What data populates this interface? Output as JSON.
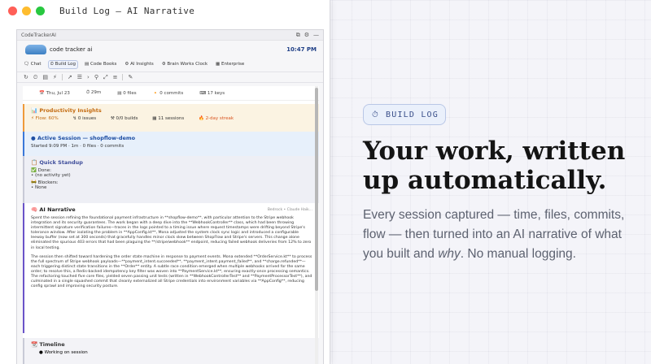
{
  "window": {
    "title": "Build Log — AI Narrative",
    "dots": [
      "#ff5f57",
      "#febc2e",
      "#28c840"
    ]
  },
  "app": {
    "frame_title": "CodeTrackerAI",
    "frame_icons": [
      "⧉",
      "⚙",
      "—"
    ],
    "brand": "code tracker ai",
    "clock": "10:47 PM",
    "tabs": [
      "Chat",
      "Build Log",
      "Code Books",
      "AI Insights",
      "Brain Works Clock",
      "Enterprise"
    ],
    "active_tab": "Build Log",
    "toolbar_icons": [
      "↻",
      "⏲",
      "▤",
      "⚡",
      "↗",
      "☰",
      "›",
      "⚲",
      "⤢",
      "≡",
      "✎"
    ]
  },
  "stats": {
    "date": "Thu, Jul 23",
    "duration": "29m",
    "files": "0 files",
    "commits": "0 commits",
    "keys": "17 keys"
  },
  "productivity": {
    "title": "Productivity Insights",
    "flow": "Flow: 60%",
    "issues": "0 issues",
    "builds": "0/0 builds",
    "sessions": "11 sessions",
    "streak": "2-day streak"
  },
  "session": {
    "title": "Active Session — shopflow-demo",
    "meta": "Started 9:09 PM · 1m · 0 files · 0 commits"
  },
  "standup": {
    "title": "Quick Standup",
    "done_label": "Done:",
    "done_item": "• (no activity yet)",
    "blockers_label": "Blockers:",
    "blockers_item": "• None"
  },
  "narrative": {
    "title": "AI Narrative",
    "model": "Bedrock • Claude Haik...",
    "p1": "Spent the session refining the foundational payment infrastructure in **shopflow-demo**, with particular attention to the Stripe webhook integration and its security guarantees. The work began with a deep dive into the **WebhookController** class, which had been throwing intermittent signature verification failures—traces in the logs pointed to a timing issue where request timestamps were drifting beyond Stripe's tolerance window. After isolating the problem in **AppConfig.kt**, Mona adjusted the system clock sync logic and introduced a configurable leeway buffer (now set at 300 seconds) that gracefully handles minor clock skew between ShopFlow and Stripe's servers. This change alone eliminated the spurious 403 errors that had been plaguing the **/stripe/webhook** endpoint, reducing failed webhook deliveries from 12% to zero in local testing.",
    "p2": "The session then shifted toward hardening the order state machine in response to payment events. Mona extended **OrderService.kt** to process the full spectrum of Stripe webhook payloads—**payment_intent.succeeded**, **payment_intent.payment_failed**, and **charge.refunded**—each triggering distinct state transitions in the **Order** entity. A subtle race condition emerged when multiple webhooks arrived for the same order; to resolve this, a Redis-backed idempotency key filter was woven into **PaymentService.kt**, ensuring exactly-once processing semantics. The refactoring touched five core files, yielded seven passing unit tests (written in **WebhookControllerTest** and **PaymentProcessorTest**), and culminated in a single squashed commit that cleanly externalized all Stripe credentials into environment variables via **AppConfig**, reducing config sprawl and improving security posture."
  },
  "timeline": {
    "title": "Timeline",
    "item": "Working on session"
  },
  "marketing": {
    "badge": "BUILD LOG",
    "headline": "Your work, written up automatically.",
    "sub_before": "Every session captured — time, files, commits, flow — then turned into an AI narrative of what you built and ",
    "sub_em": "why",
    "sub_after": ". No manual logging."
  }
}
